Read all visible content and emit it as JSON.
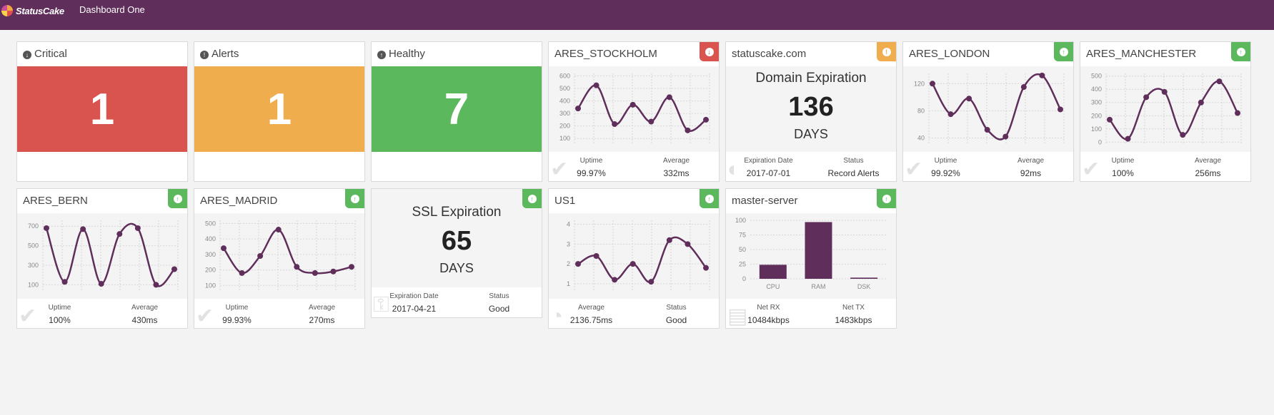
{
  "header": {
    "logo_text": "StatusCake",
    "dashboard_title": "Dashboard One"
  },
  "summary": {
    "critical": {
      "label": "Critical",
      "count": "1",
      "icon": "arrow-circle-down-icon"
    },
    "alerts": {
      "label": "Alerts",
      "count": "1",
      "icon": "exclamation-circle-icon"
    },
    "healthy": {
      "label": "Healthy",
      "count": "7",
      "icon": "arrow-circle-up-icon"
    }
  },
  "tests": {
    "stockholm": {
      "name": "ARES_STOCKHOLM",
      "status": "down",
      "stat1_label": "Uptime",
      "stat1_value": "99.97%",
      "stat2_label": "Average",
      "stat2_value": "332ms",
      "chart_data": {
        "type": "line",
        "yticks": [
          100,
          200,
          300,
          400,
          500,
          600
        ],
        "ylim": [
          50,
          620
        ],
        "values": [
          340,
          525,
          215,
          370,
          235,
          430,
          165,
          250
        ]
      }
    },
    "domain": {
      "name": "statuscake.com",
      "status": "warning",
      "title": "Domain Expiration",
      "number": "136",
      "unit": "DAYS",
      "stat1_label": "Expiration Date",
      "stat1_value": "2017-07-01",
      "stat2_label": "Status",
      "stat2_value": "Record Alerts"
    },
    "london": {
      "name": "ARES_LONDON",
      "status": "up",
      "stat1_label": "Uptime",
      "stat1_value": "99.92%",
      "stat2_label": "Average",
      "stat2_value": "92ms",
      "chart_data": {
        "type": "line",
        "yticks": [
          40,
          80,
          120
        ],
        "ylim": [
          30,
          135
        ],
        "values": [
          120,
          75,
          98,
          52,
          42,
          115,
          132,
          82
        ]
      }
    },
    "manchester": {
      "name": "ARES_MANCHESTER",
      "status": "up",
      "stat1_label": "Uptime",
      "stat1_value": "100%",
      "stat2_label": "Average",
      "stat2_value": "256ms",
      "chart_data": {
        "type": "line",
        "yticks": [
          0,
          100,
          200,
          300,
          400,
          500
        ],
        "ylim": [
          -20,
          520
        ],
        "values": [
          170,
          25,
          340,
          380,
          55,
          300,
          460,
          220
        ]
      }
    },
    "bern": {
      "name": "ARES_BERN",
      "status": "up",
      "stat1_label": "Uptime",
      "stat1_value": "100%",
      "stat2_label": "Average",
      "stat2_value": "430ms",
      "chart_data": {
        "type": "line",
        "yticks": [
          100,
          300,
          500,
          700
        ],
        "ylim": [
          30,
          760
        ],
        "values": [
          680,
          130,
          670,
          110,
          620,
          680,
          100,
          260
        ]
      }
    },
    "madrid": {
      "name": "ARES_MADRID",
      "status": "up",
      "stat1_label": "Uptime",
      "stat1_value": "99.93%",
      "stat2_label": "Average",
      "stat2_value": "270ms",
      "chart_data": {
        "type": "line",
        "yticks": [
          100,
          200,
          300,
          400,
          500
        ],
        "ylim": [
          60,
          520
        ],
        "values": [
          340,
          180,
          290,
          460,
          220,
          180,
          190,
          220
        ]
      }
    },
    "ssl": {
      "name": "",
      "status": "up",
      "title": "SSL Expiration",
      "number": "65",
      "unit": "DAYS",
      "stat1_label": "Expiration Date",
      "stat1_value": "2017-04-21",
      "stat2_label": "Status",
      "stat2_value": "Good"
    },
    "us1": {
      "name": "US1",
      "status": "up",
      "stat1_label": "Average",
      "stat1_value": "2136.75ms",
      "stat2_label": "Status",
      "stat2_value": "Good",
      "chart_data": {
        "type": "line",
        "yticks": [
          1,
          2,
          3,
          4
        ],
        "ylim": [
          0.6,
          4.2
        ],
        "values": [
          2.0,
          2.4,
          1.2,
          2.0,
          1.1,
          3.2,
          3.0,
          1.8
        ]
      }
    },
    "master": {
      "name": "master-server",
      "status": "up",
      "stat1_label": "Net RX",
      "stat1_value": "10484kbps",
      "stat2_label": "Net TX",
      "stat2_value": "1483kbps",
      "chart_data": {
        "type": "bar",
        "categories": [
          "CPU",
          "RAM",
          "DSK"
        ],
        "values": [
          24,
          97,
          2
        ],
        "yticks": [
          0,
          25,
          50,
          75,
          100
        ],
        "ylim": [
          0,
          100
        ]
      }
    }
  }
}
